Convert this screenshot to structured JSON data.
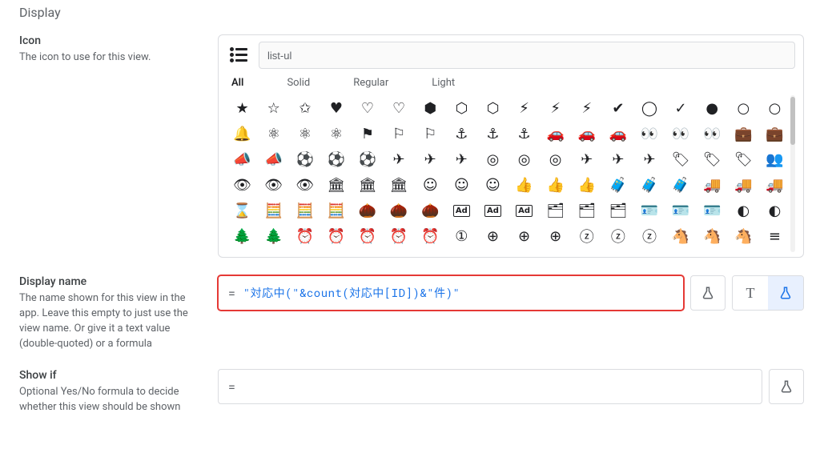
{
  "section": {
    "title": "Display"
  },
  "icon_field": {
    "label": "Icon",
    "desc": "The icon to use for this view.",
    "search": "list-ul",
    "current_icon": "list-ul",
    "tabs": [
      "All",
      "Solid",
      "Regular",
      "Light"
    ],
    "active_tab": 0,
    "grid": [
      [
        "★",
        "☆",
        "✩",
        "♥",
        "♡",
        "♡",
        "⬢",
        "⬡",
        "⬡",
        "⚡",
        "⚡",
        "⚡",
        "✔",
        "◯",
        "✓",
        "●",
        "○",
        "○",
        "🔔",
        "🔔"
      ],
      [
        "🔔",
        "⚛",
        "⚛",
        "⚛",
        "⚑",
        "⚐",
        "⚐",
        "⚓",
        "⚓",
        "⚓",
        "🚗",
        "🚗",
        "🚗",
        "👀",
        "👀",
        "👀",
        "💼",
        "💼",
        "💼",
        "📣"
      ],
      [
        "📣",
        "📣",
        "⚽",
        "⚽",
        "⚽",
        "✈",
        "✈",
        "✈",
        "◎",
        "◎",
        "◎",
        "✈",
        "✈",
        "✈",
        "🏷",
        "🏷",
        "🏷",
        "👥",
        "👥",
        "👥"
      ],
      [
        "👁",
        "👁",
        "👁",
        "🏛",
        "🏛",
        "🏛",
        "☺",
        "☺",
        "☺",
        "👍",
        "👍",
        "👍",
        "🧳",
        "🧳",
        "🧳",
        "🚚",
        "🚚",
        "🚚",
        "⌛",
        "⌛"
      ],
      [
        "⌛",
        "🧮",
        "🧮",
        "🧮",
        "🌰",
        "🌰",
        "🌰",
        "Ad",
        "Ad",
        "Ad",
        "🗂",
        "🗂",
        "🗂",
        "🪪",
        "🪪",
        "🪪",
        "◐",
        "◐",
        "◐",
        "🏰"
      ],
      [
        "🌲",
        "🌲",
        "⏰",
        "⏰",
        "⏰",
        "⏰",
        "⏰",
        "①",
        "⊕",
        "⊕",
        "⊕",
        "ⓩ",
        "ⓩ",
        "ⓩ",
        "🐴",
        "🐴",
        "🐴",
        "≡",
        "≡",
        "≡"
      ]
    ]
  },
  "display_name_field": {
    "label": "Display name",
    "desc": "The name shown for this view in the app. Leave this empty to just use the view name. Or give it a text value (double-quoted) or a formula",
    "eq": "=",
    "formula": "\"対応中(\"&count(対応中[ID])&\"件)\"",
    "mode": "formula"
  },
  "show_if_field": {
    "label": "Show if",
    "desc": "Optional Yes/No formula to decide whether this view should be shown",
    "eq": "=",
    "formula": ""
  },
  "icons": {
    "flask": "flask",
    "text_mode": "T"
  }
}
